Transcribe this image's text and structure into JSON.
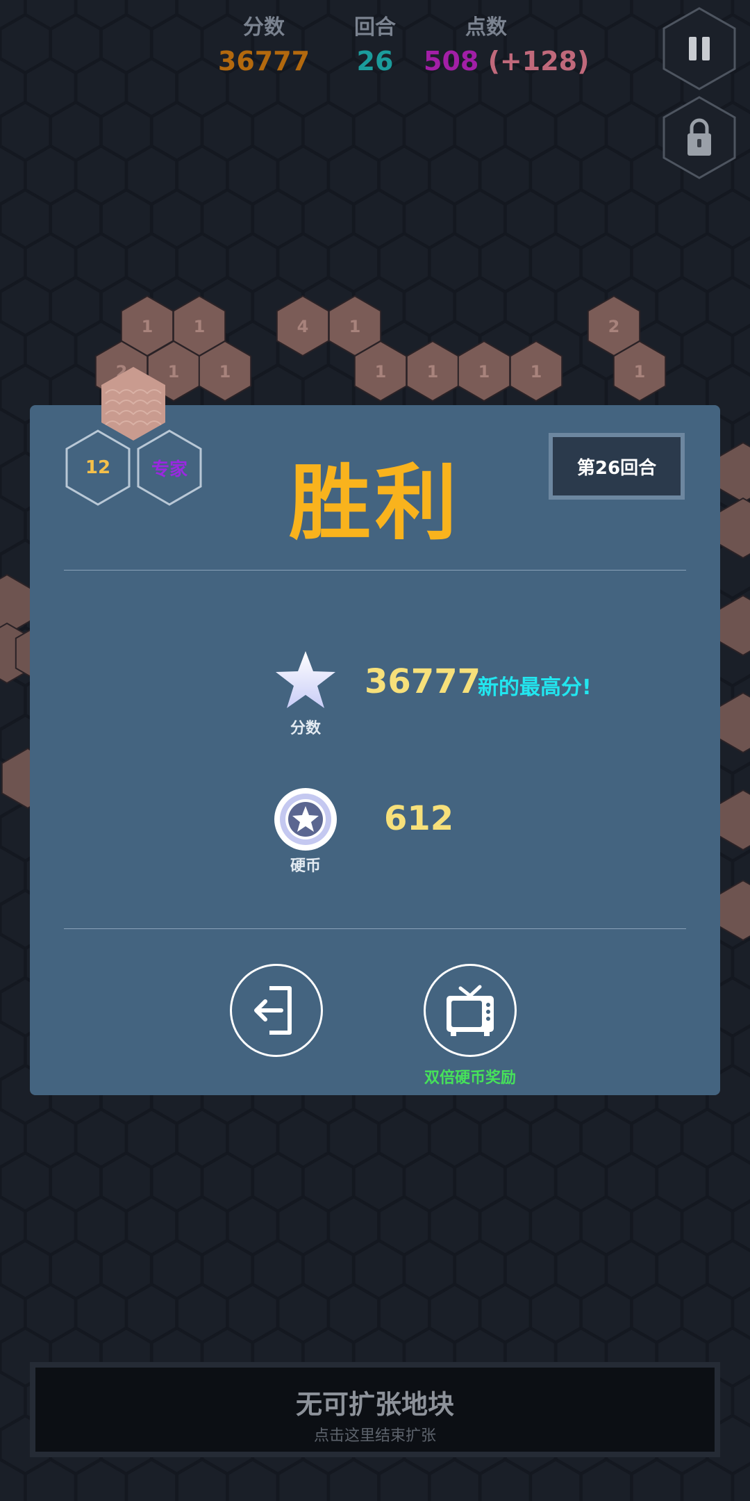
{
  "hud": {
    "score_label": "分数",
    "score_value": "36777",
    "round_label": "回合",
    "round_value": "26",
    "points_label": "点数",
    "points_value": "508",
    "points_bonus": "(+128)"
  },
  "colors": {
    "score": "#b3690e",
    "round": "#1b9c9c",
    "points": "#a21fa6",
    "points_bonus": "#c0697b",
    "victory": "#f9b31d",
    "dialog": "#446480",
    "tile": "#7b5c57"
  },
  "buttons": {
    "pause_icon": "pause-icon",
    "lock_icon": "lock-icon"
  },
  "board": {
    "tiles": [
      {
        "label": "1"
      },
      {
        "label": "1"
      },
      {
        "label": "4"
      },
      {
        "label": "1"
      },
      {
        "label": "2"
      },
      {
        "label": "2"
      },
      {
        "label": "1"
      },
      {
        "label": "1"
      },
      {
        "label": "1"
      },
      {
        "label": "1"
      },
      {
        "label": "1"
      },
      {
        "label": "1"
      },
      {
        "label": "1"
      }
    ]
  },
  "dialog": {
    "level_number": "12",
    "difficulty": "专家",
    "title": "胜利",
    "round_badge": "第26回合",
    "score_icon": "star-icon",
    "score_label": "分数",
    "score_value": "36777",
    "new_highscore": "新的最高分!",
    "coin_icon": "coin-icon",
    "coin_label": "硬币",
    "coin_value": "612",
    "exit_icon": "exit-icon",
    "tv_icon": "tv-icon",
    "double_reward_label": "双倍硬币奖励"
  },
  "bottom": {
    "main_text": "无可扩张地块",
    "sub_text": "点击这里结束扩张"
  }
}
